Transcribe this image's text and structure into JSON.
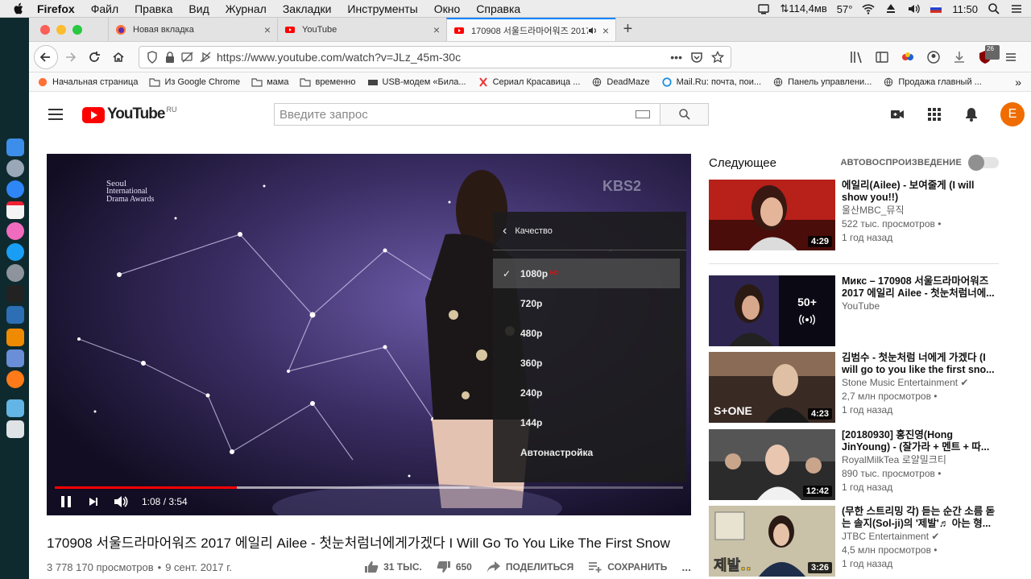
{
  "menubar": {
    "app": "Firefox",
    "items": [
      "Файл",
      "Правка",
      "Вид",
      "Журнал",
      "Закладки",
      "Инструменты",
      "Окно",
      "Справка"
    ],
    "status": {
      "net": "114,4мв",
      "temp": "57°",
      "time": "11:50"
    }
  },
  "tabs": [
    {
      "title": "Новая вкладка",
      "close": "×"
    },
    {
      "title": "YouTube",
      "close": "×"
    },
    {
      "title": "170908 서울드라마어워즈 2017 ",
      "close": "×"
    }
  ],
  "newtab": "+",
  "nav": {
    "url": "https://www.youtube.com/watch?v=JLz_45m-30c",
    "badge": "26"
  },
  "bookmarks": [
    "Начальная страница",
    "Из Google Chrome",
    "мама",
    "временно",
    "USB-модем «Била...",
    "Сериал Красавица ...",
    "DeadMaze",
    "Mail.Ru: почта, пои...",
    "Панель управлени...",
    "Продажа главный ..."
  ],
  "yt": {
    "logo": "YouTube",
    "country": "RU",
    "search_placeholder": "Введите запрос",
    "avatar": "E"
  },
  "player": {
    "event_logo": [
      "Seoul",
      "International",
      "Drama Awards"
    ],
    "channel_mark": "KBS2",
    "quality_menu": {
      "header": "Качество",
      "options": [
        "1080p",
        "720p",
        "480p",
        "360p",
        "240p",
        "144p",
        "Автонастройка"
      ],
      "selected": "1080p",
      "hd": "HD"
    },
    "time": "1:08 / 3:54",
    "progress": 0.29,
    "buffered": 0.66
  },
  "video": {
    "title": "170908 서울드라마어워즈 2017 에일리 Ailee - 첫눈처럼너에게가겠다 I Will Go To You Like The First Snow",
    "views": "3 778 170 просмотров",
    "date": "9 сент. 2017 г.",
    "likes": "31 ТЫС.",
    "dislikes": "650",
    "share": "ПОДЕЛИТЬСЯ",
    "save": "СОХРАНИТЬ",
    "more": "..."
  },
  "upnext": {
    "title": "Следующее",
    "autoplay": "АВТОВОСПРОИЗВЕДЕНИЕ",
    "items": [
      {
        "title": "에일리(Ailee) - 보여줄게 (I will show you!!)",
        "channel": "울산MBC_뮤직",
        "views": "522 тыс. просмотров",
        "ago": "1 год назад",
        "duration": "4:29"
      },
      {
        "title": "Микс – 170908 서울드라마어워즈 2017 에일리 Ailee - 첫눈처럼너에...",
        "channel": "YouTube",
        "views": "",
        "ago": "",
        "duration": "",
        "mix": "50+"
      },
      {
        "title": "김범수 - 첫눈처럼 너에게 가겠다 (I will go to you like the first sno...",
        "channel": "Stone Music Entertainment",
        "views": "2,7 млн просмотров",
        "ago": "1 год назад",
        "duration": "4:23"
      },
      {
        "title": "[20180930] 홍진영(Hong JinYoung) - (잘가라 + 멘트 + 따...",
        "channel": "RoyalMilkTea 로얄밀크티",
        "views": "890 тыс. просмотров",
        "ago": "1 год назад",
        "duration": "12:42"
      },
      {
        "title": "(무한 스트리밍 각) 듣는 순간 소름 돋는 솔지(Sol-ji)의 '제발'♬ 아는 형...",
        "channel": "JTBC Entertainment",
        "views": "4,5 млн просмотров",
        "ago": "1 год назад",
        "duration": "3:26"
      }
    ]
  }
}
